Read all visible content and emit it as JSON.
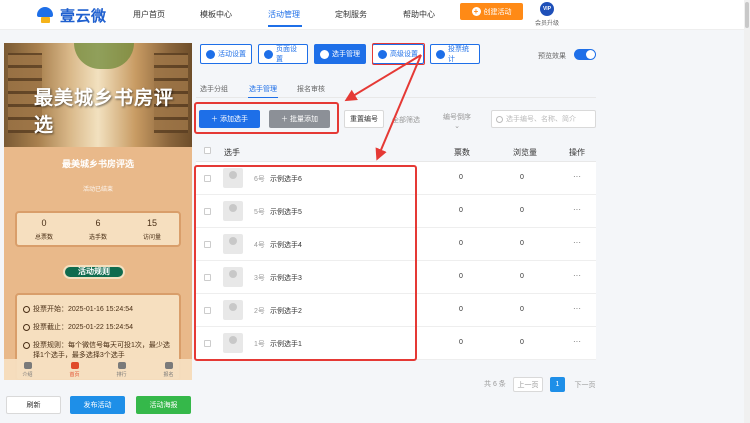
{
  "header": {
    "logo_text": "壹云微",
    "nav": [
      "用户首页",
      "模板中心",
      "活动管理",
      "定制服务",
      "帮助中心"
    ],
    "active_nav": "活动管理",
    "create_button": "创建活动",
    "vip_badge": "VIP",
    "vip_label": "会员升级"
  },
  "preview": {
    "banner_title": "最美城乡书房评选",
    "title": "最美城乡书房评选",
    "subtitle": "活动已结束",
    "stats": [
      {
        "value": "0",
        "label": "总票数"
      },
      {
        "value": "6",
        "label": "选手数"
      },
      {
        "value": "15",
        "label": "访问量"
      }
    ],
    "rules_button": "活动规则",
    "info": [
      "投票开始：2025-01-16 15:24:54",
      "投票截止：2025-01-22 15:24:54",
      "投票规则：每个微信号每天可投1次，最少选择1个选手，最多选择3个选手"
    ],
    "tabs": [
      "介绍",
      "首页",
      "排行",
      "报名"
    ],
    "active_tab": "首页"
  },
  "actions": {
    "refresh": "刷新",
    "publish": "发布活动",
    "poster": "活动海报"
  },
  "toolbar": {
    "buttons": [
      "活动设置",
      "页面设置",
      "选手管理",
      "高级设置",
      "投票统计"
    ],
    "active": "选手管理",
    "preview_label": "预览效果",
    "preview_on": true
  },
  "subtabs": [
    "选手分组",
    "选手管理",
    "报名审核"
  ],
  "active_subtab": "选手管理",
  "controls": {
    "add_button": "＋ 添加选手",
    "batch_button": "＋ 批量添加",
    "reorder_button": "重置编号",
    "filter_label": "全部筛选",
    "sort_label": "编号倒序",
    "search_placeholder": "选手编号、名称、简介"
  },
  "table": {
    "headers": {
      "player": "选手",
      "votes": "票数",
      "views": "浏览量",
      "ops": "操作"
    },
    "rows": [
      {
        "num": "6号",
        "name": "示例选手6",
        "votes": "0",
        "views": "0",
        "more": "···"
      },
      {
        "num": "5号",
        "name": "示例选手5",
        "votes": "0",
        "views": "0",
        "more": "···"
      },
      {
        "num": "4号",
        "name": "示例选手4",
        "votes": "0",
        "views": "0",
        "more": "···"
      },
      {
        "num": "3号",
        "name": "示例选手3",
        "votes": "0",
        "views": "0",
        "more": "···"
      },
      {
        "num": "2号",
        "name": "示例选手2",
        "votes": "0",
        "views": "0",
        "more": "···"
      },
      {
        "num": "1号",
        "name": "示例选手1",
        "votes": "0",
        "views": "0",
        "more": "···"
      }
    ]
  },
  "pagination": {
    "total": "共 6 条",
    "prev": "上一页",
    "current": "1",
    "next": "下一页"
  },
  "colors": {
    "primary": "#1e6fe8",
    "create": "#ff8a16",
    "annotation": "#e53935",
    "poster": "#35b84a"
  }
}
